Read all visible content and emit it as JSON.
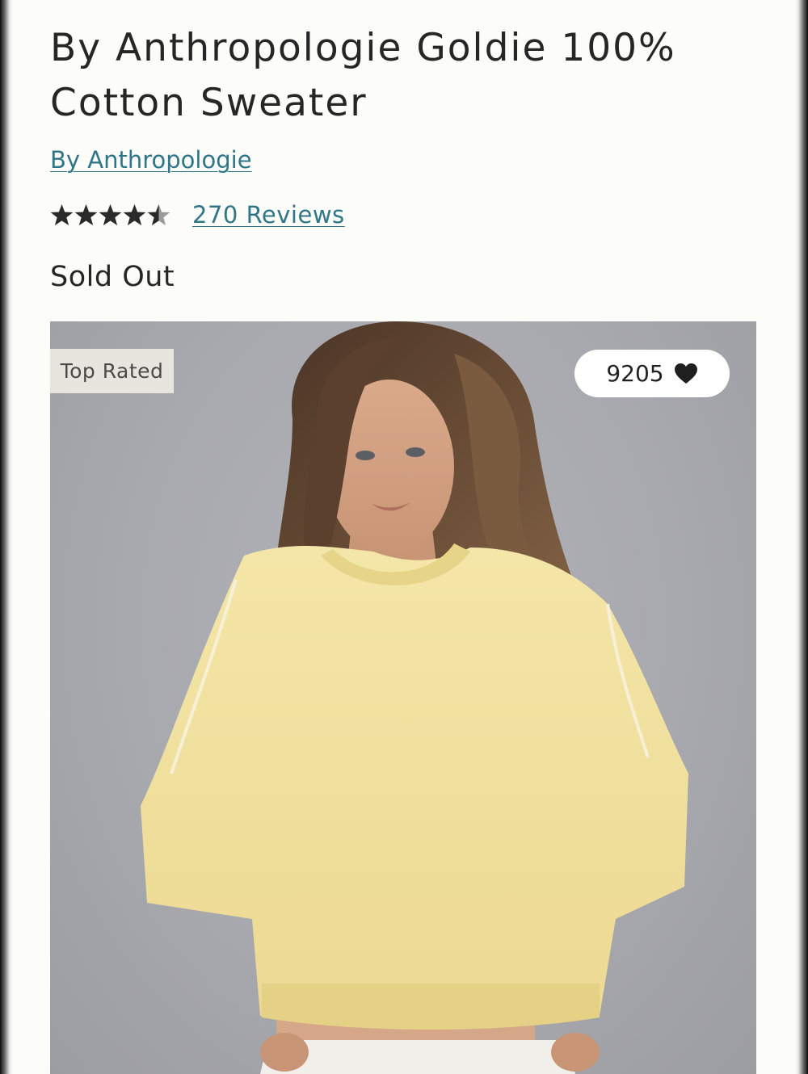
{
  "product": {
    "title": "By Anthropologie Goldie 100% Cotton Sweater",
    "brand_link": "By Anthropologie",
    "rating": 4.5,
    "rating_max": 5,
    "reviews_link": "270 Reviews",
    "stock_status": "Sold Out"
  },
  "image": {
    "badge": "Top Rated",
    "favorites_count": "9205",
    "heart_icon": "heart-icon"
  },
  "colors": {
    "link": "#2f7689",
    "text": "#262626",
    "background": "#fcfcf9",
    "star": "#2a2a2a"
  }
}
